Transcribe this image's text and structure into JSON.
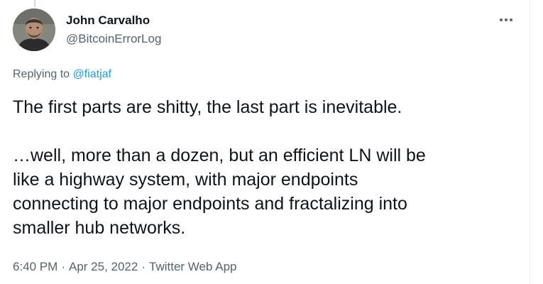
{
  "author": {
    "display_name": "John Carvalho",
    "handle": "@BitcoinErrorLog",
    "avatar_icon": "avatar-photo-icon"
  },
  "reply": {
    "prefix": "Replying to ",
    "mention": "@fiatjaf"
  },
  "tweet": {
    "paragraph_1": "The first parts are shitty, the last part is inevitable.",
    "paragraph_2_lines": [
      "…well, more than a dozen, but an efficient LN will be",
      "like a highway system, with major endpoints",
      "connecting to major endpoints and fractalizing into",
      "smaller hub networks."
    ]
  },
  "meta": {
    "time": "6:40 PM",
    "separator": "·",
    "date": "Apr 25, 2022",
    "source": "Twitter Web App"
  },
  "colors": {
    "text_primary": "#0f1419",
    "text_secondary": "#536471",
    "link": "#1d9bf0",
    "border": "#eff3f4"
  }
}
